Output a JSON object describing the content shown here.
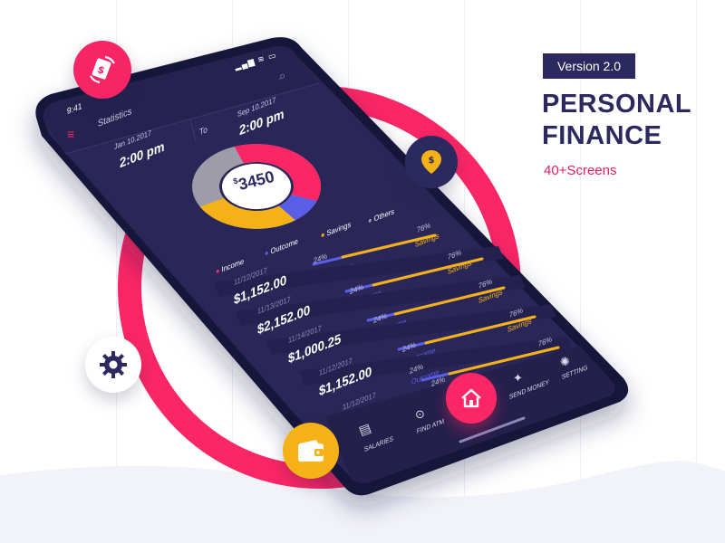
{
  "promo": {
    "version_label": "Version 2.0",
    "title_line1": "PERSONAL",
    "title_line2": "FINANCE",
    "subtitle": "40+Screens"
  },
  "status_bar": {
    "time": "9:41"
  },
  "header": {
    "title": "Statistics",
    "from_date": "Jan 10.2017",
    "from_time": "2:00 pm",
    "to_label": "To",
    "to_date": "Sep 10.2017",
    "to_time": "2:00 pm"
  },
  "donut": {
    "total": "3450",
    "currency": "$",
    "segments": [
      {
        "name": "Income",
        "color": "#fb2665",
        "value": 36
      },
      {
        "name": "Outcome",
        "color": "#5a5ee6",
        "value": 9
      },
      {
        "name": "Savings",
        "color": "#f5b216",
        "value": 27
      },
      {
        "name": "Others",
        "color": "#9d9ca8",
        "value": 28
      }
    ]
  },
  "legend": [
    "Income",
    "Outcome",
    "Savings",
    "Others"
  ],
  "transactions": [
    {
      "date": "11/12/2017",
      "amount": "$1,152.00",
      "outcome_pct": "24%",
      "outcome_label": "Outcome",
      "savings_pct": "76%",
      "savings_label": "Savings"
    },
    {
      "date": "11/13/2017",
      "amount": "$2,152.00",
      "outcome_pct": "24%",
      "outcome_label": "Outcome",
      "savings_pct": "76%",
      "savings_label": "Savings"
    },
    {
      "date": "11/14/2017",
      "amount": "$1,000.25",
      "outcome_pct": "24%",
      "outcome_label": "Outcome",
      "savings_pct": "76%",
      "savings_label": "Savings"
    },
    {
      "date": "11/12/2017",
      "amount": "$1,152.00",
      "outcome_pct": "24%",
      "outcome_label": "Outcome",
      "savings_pct": "76%",
      "savings_label": "Savings"
    },
    {
      "date": "11/12/2017",
      "amount": "",
      "outcome_pct": "24%",
      "outcome_label": "",
      "savings_pct": "76%",
      "savings_label": ""
    }
  ],
  "first_row": {
    "outcome_pct": "24%",
    "outcome_label": "Outcome",
    "savings_pct": "76%",
    "savings_label": "Savings"
  },
  "bottom_nav": {
    "salaries": "SALARIES",
    "find_atm": "FIND ATM",
    "send_money": "SEND MONEY",
    "setting": "SETTING"
  },
  "colors": {
    "accent": "#fb2665",
    "navy": "#2b2960",
    "gold": "#f5b216",
    "blue": "#5a5ee6"
  },
  "icons": [
    "money-exchange-icon",
    "location-pin-icon",
    "gear-icon",
    "wallet-icon",
    "home-icon"
  ]
}
